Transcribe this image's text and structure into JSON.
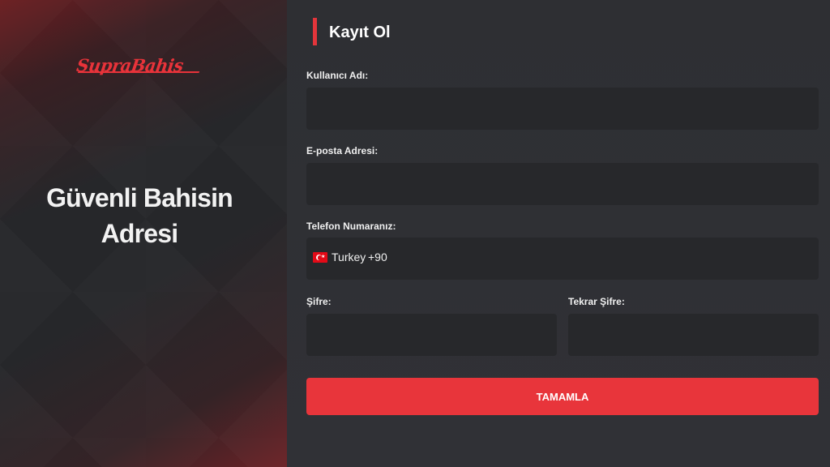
{
  "brand": {
    "logo_text": "SupraBahis",
    "tagline_line1": "Güvenli Bahisin",
    "tagline_line2": "Adresi",
    "accent_color": "#e8353b"
  },
  "form": {
    "title": "Kayıt Ol",
    "username_label": "Kullanıcı Adı:",
    "username_value": "",
    "email_label": "E-posta Adresi:",
    "email_value": "",
    "phone_label": "Telefon Numaranız:",
    "phone_country": "Turkey",
    "phone_code": "+90",
    "phone_value": "",
    "flag_icon": "turkey-flag-icon",
    "password_label": "Şifre:",
    "password_value": "",
    "password_repeat_label": "Tekrar Şifre:",
    "password_repeat_value": "",
    "submit_label": "TAMAMLA"
  }
}
